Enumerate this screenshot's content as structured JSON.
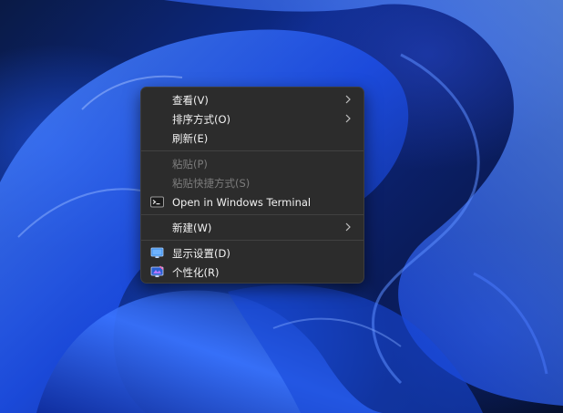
{
  "context_menu": {
    "view_label": "查看(V)",
    "sort_label": "排序方式(O)",
    "refresh_label": "刷新(E)",
    "paste_label": "粘贴(P)",
    "paste_shortcut_label": "粘贴快捷方式(S)",
    "terminal_label": "Open in Windows Terminal",
    "new_label": "新建(W)",
    "display_settings_label": "显示设置(D)",
    "personalize_label": "个性化(R)"
  },
  "icons": {
    "terminal": "terminal-icon",
    "display": "display-settings-icon",
    "personalize": "personalize-icon",
    "submenu": "chevron-right-icon"
  },
  "colors": {
    "menu_background": "#2c2c2c",
    "menu_text": "#f2f2f2",
    "disabled_text": "#7c7c7c",
    "wallpaper_blue": "#1e5cff"
  }
}
